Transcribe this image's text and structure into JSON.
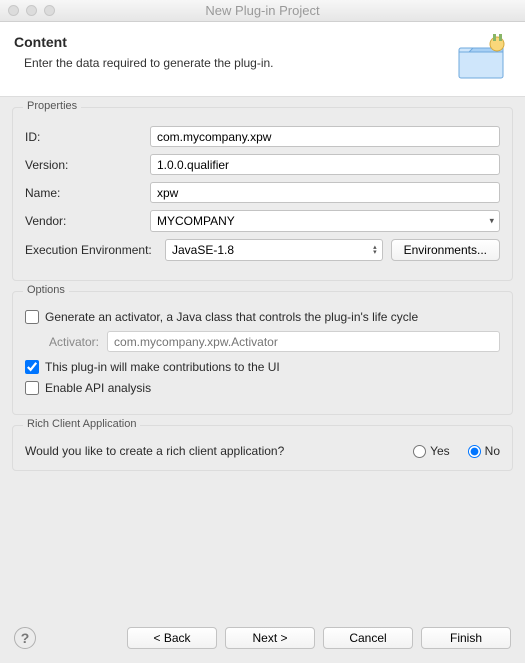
{
  "window": {
    "title": "New Plug-in Project"
  },
  "header": {
    "title": "Content",
    "subtitle": "Enter the data required to generate the plug-in."
  },
  "properties": {
    "group_label": "Properties",
    "id_label": "ID:",
    "id_value": "com.mycompany.xpw",
    "version_label": "Version:",
    "version_value": "1.0.0.qualifier",
    "name_label": "Name:",
    "name_value": "xpw",
    "vendor_label": "Vendor:",
    "vendor_value": "MYCOMPANY",
    "exec_env_label": "Execution Environment:",
    "exec_env_value": "JavaSE-1.8",
    "environments_button": "Environments..."
  },
  "options": {
    "group_label": "Options",
    "generate_activator": "Generate an activator, a Java class that controls the plug-in's life cycle",
    "activator_label": "Activator:",
    "activator_placeholder": "com.mycompany.xpw.Activator",
    "ui_contributions": "This plug-in will make contributions to the UI",
    "enable_api": "Enable API analysis"
  },
  "rca": {
    "group_label": "Rich Client Application",
    "question": "Would you like to create a rich client application?",
    "yes": "Yes",
    "no": "No"
  },
  "buttons": {
    "back": "< Back",
    "next": "Next >",
    "cancel": "Cancel",
    "finish": "Finish"
  }
}
